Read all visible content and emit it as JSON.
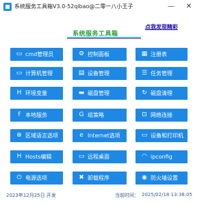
{
  "window": {
    "title": "系统服务工具箱V3.0-52qibao@二零一八小王子",
    "minimize_glyph": "—",
    "close_glyph": "✕"
  },
  "header": {
    "title": "系统服务工具箱",
    "discover_link": "点我发现精彩"
  },
  "buttons": [
    [
      {
        "label": "cmd管理员",
        "icon": "cmd-icon",
        "glyph": "▭"
      },
      {
        "label": "控制面板",
        "icon": "gear-icon",
        "glyph": "⚙"
      },
      {
        "label": "注册表",
        "icon": "registry-icon",
        "glyph": "▦"
      }
    ],
    [
      {
        "label": "计算机管理",
        "icon": "monitor-icon",
        "glyph": "▭"
      },
      {
        "label": "设备管理",
        "icon": "device-icon",
        "glyph": "▤"
      },
      {
        "label": "任务管理",
        "icon": "task-list-icon",
        "glyph": "☰"
      }
    ],
    [
      {
        "label": "环境变量",
        "icon": "letter-h-icon",
        "glyph": "H"
      },
      {
        "label": "磁盘管理",
        "icon": "disk-icon",
        "glyph": "▬"
      },
      {
        "label": "磁盘清理",
        "icon": "refresh-icon",
        "glyph": "↻"
      }
    ],
    [
      {
        "label": "本地服务",
        "icon": "facebook-icon",
        "glyph": "f"
      },
      {
        "label": "组策略",
        "icon": "letter-g-icon",
        "glyph": "G"
      },
      {
        "label": "网络连接",
        "icon": "network-icon",
        "glyph": "⊡"
      }
    ],
    [
      {
        "label": "区域语言选项",
        "icon": "globe-icon",
        "glyph": "⊕"
      },
      {
        "label": "Internet选项",
        "icon": "internet-explorer-icon",
        "glyph": "e"
      },
      {
        "label": "设备和打印机",
        "icon": "printer-icon",
        "glyph": "▭"
      }
    ],
    [
      {
        "label": "Hosts编辑",
        "icon": "hosts-icon",
        "glyph": "H"
      },
      {
        "label": "远程桌面",
        "icon": "remote-desktop-icon",
        "glyph": "▭"
      },
      {
        "label": "ipconfig",
        "icon": "wifi-icon",
        "glyph": "◠"
      }
    ],
    [
      {
        "label": "电源选项",
        "icon": "power-icon",
        "glyph": "⏻"
      },
      {
        "label": "卸载程序",
        "icon": "uninstall-icon",
        "glyph": "✖"
      },
      {
        "label": "防火墙设置",
        "icon": "firewall-icon",
        "glyph": "◉"
      }
    ]
  ],
  "footer": {
    "date_text": "2023年12月25日 开发",
    "current_time_label": "当前时间：",
    "current_time": "2025/02/18 13:38:05"
  },
  "colors": {
    "button_bg": "#1e88e5",
    "header_green": "#2f9e3f",
    "link_blue": "#1a0dab"
  }
}
